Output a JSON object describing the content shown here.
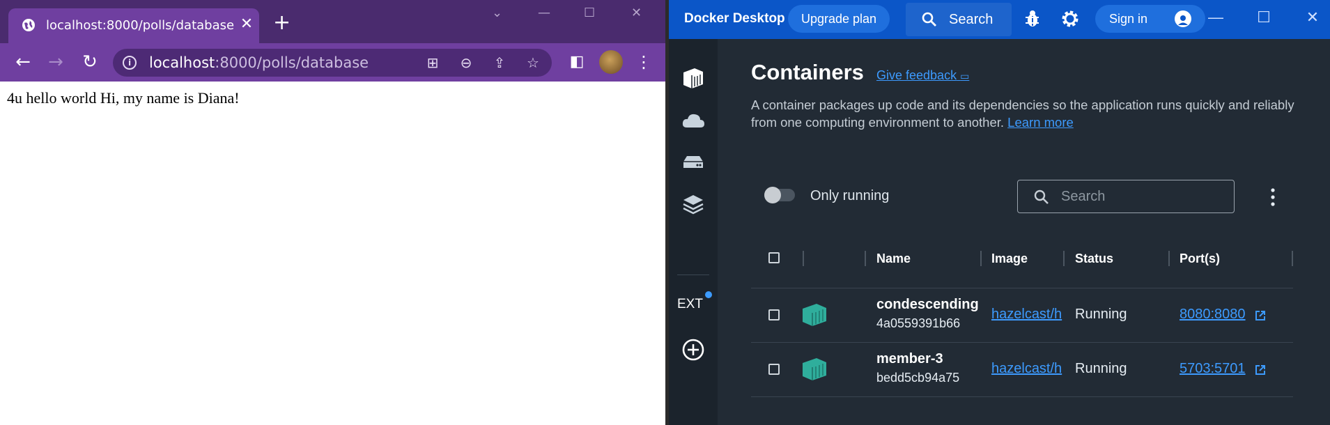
{
  "browser": {
    "tab_title": "localhost:8000/polls/database",
    "new_tab_label": "+",
    "url_host": "localhost",
    "url_rest": ":8000/polls/database",
    "page_text": "4u hello world Hi, my name is Diana!"
  },
  "docker": {
    "app_title": "Docker Desktop",
    "upgrade_label": "Upgrade plan",
    "search_label": "Search",
    "signin_label": "Sign in",
    "sidebar_ext_label": "EXT",
    "page_title": "Containers",
    "feedback_label": "Give feedback",
    "description": "A container packages up code and its dependencies so the application runs quickly and reliably from one computing environment to another.",
    "learn_more": "Learn more",
    "only_running_label": "Only running",
    "filter_placeholder": "Search",
    "columns": [
      "Name",
      "Image",
      "Status",
      "Port(s)"
    ],
    "containers": [
      {
        "name": "condescending",
        "id": "4a0559391b66",
        "image": "hazelcast/h",
        "status": "Running",
        "port": "8080:8080"
      },
      {
        "name": "member-3",
        "id": "bedd5cb94a75",
        "image": "hazelcast/h",
        "status": "Running",
        "port": "5703:5701"
      }
    ],
    "accent_color": "#0b56c8",
    "link_color": "#3d9bff",
    "container_icon_color": "#2fae9c"
  }
}
